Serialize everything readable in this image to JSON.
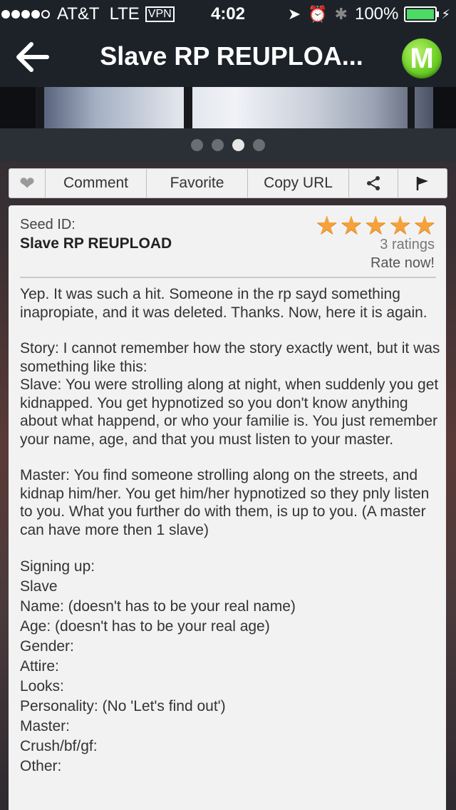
{
  "status_bar": {
    "carrier": "AT&T",
    "network": "LTE",
    "vpn": "VPN",
    "time": "4:02",
    "battery": "100%"
  },
  "nav": {
    "title": "Slave RP REUPLOA..."
  },
  "pager": {
    "count": 4,
    "active_index": 2
  },
  "actions": {
    "comment": "Comment",
    "favorite": "Favorite",
    "copy_url": "Copy URL"
  },
  "seed": {
    "label": "Seed ID:",
    "name": "Slave RP REUPLOAD",
    "rating_stars": 5,
    "ratings": "3 ratings",
    "rate_now": "Rate now!"
  },
  "description": {
    "intro": "Yep. It was such a hit. Someone in the rp sayd something inapropiate, and it was deleted. Thanks. Now, here it is again.",
    "story_1": "Story: I cannot remember how the story exactly went, but it was something like this:",
    "story_2": "Slave: You were strolling along at night, when suddenly you get kidnapped. You get hypnotized so you don't know anything about what happend, or who your familie is. You just remember your name, age, and that you must listen to your master.",
    "master": "Master: You find someone strolling along on the streets, and kidnap him/her. You get him/her hypnotized so they pnly listen to you. What you further do with them, is up to you. (A master can have more then 1 slave)",
    "signup_lines": [
      "Signing up:",
      "Slave",
      "Name: (doesn't has to be your real name)",
      "Age: (doesn't has to be your real age)",
      "Gender:",
      "Attire:",
      "Looks:",
      "Personality: (No 'Let's find out')",
      "Master:",
      "Crush/bf/gf:",
      "Other:"
    ]
  },
  "colors": {
    "bar_bg": "#1d2229",
    "star": "#f5a23c",
    "logo_green": "#6fcf28",
    "battery_green": "#4cd964"
  }
}
